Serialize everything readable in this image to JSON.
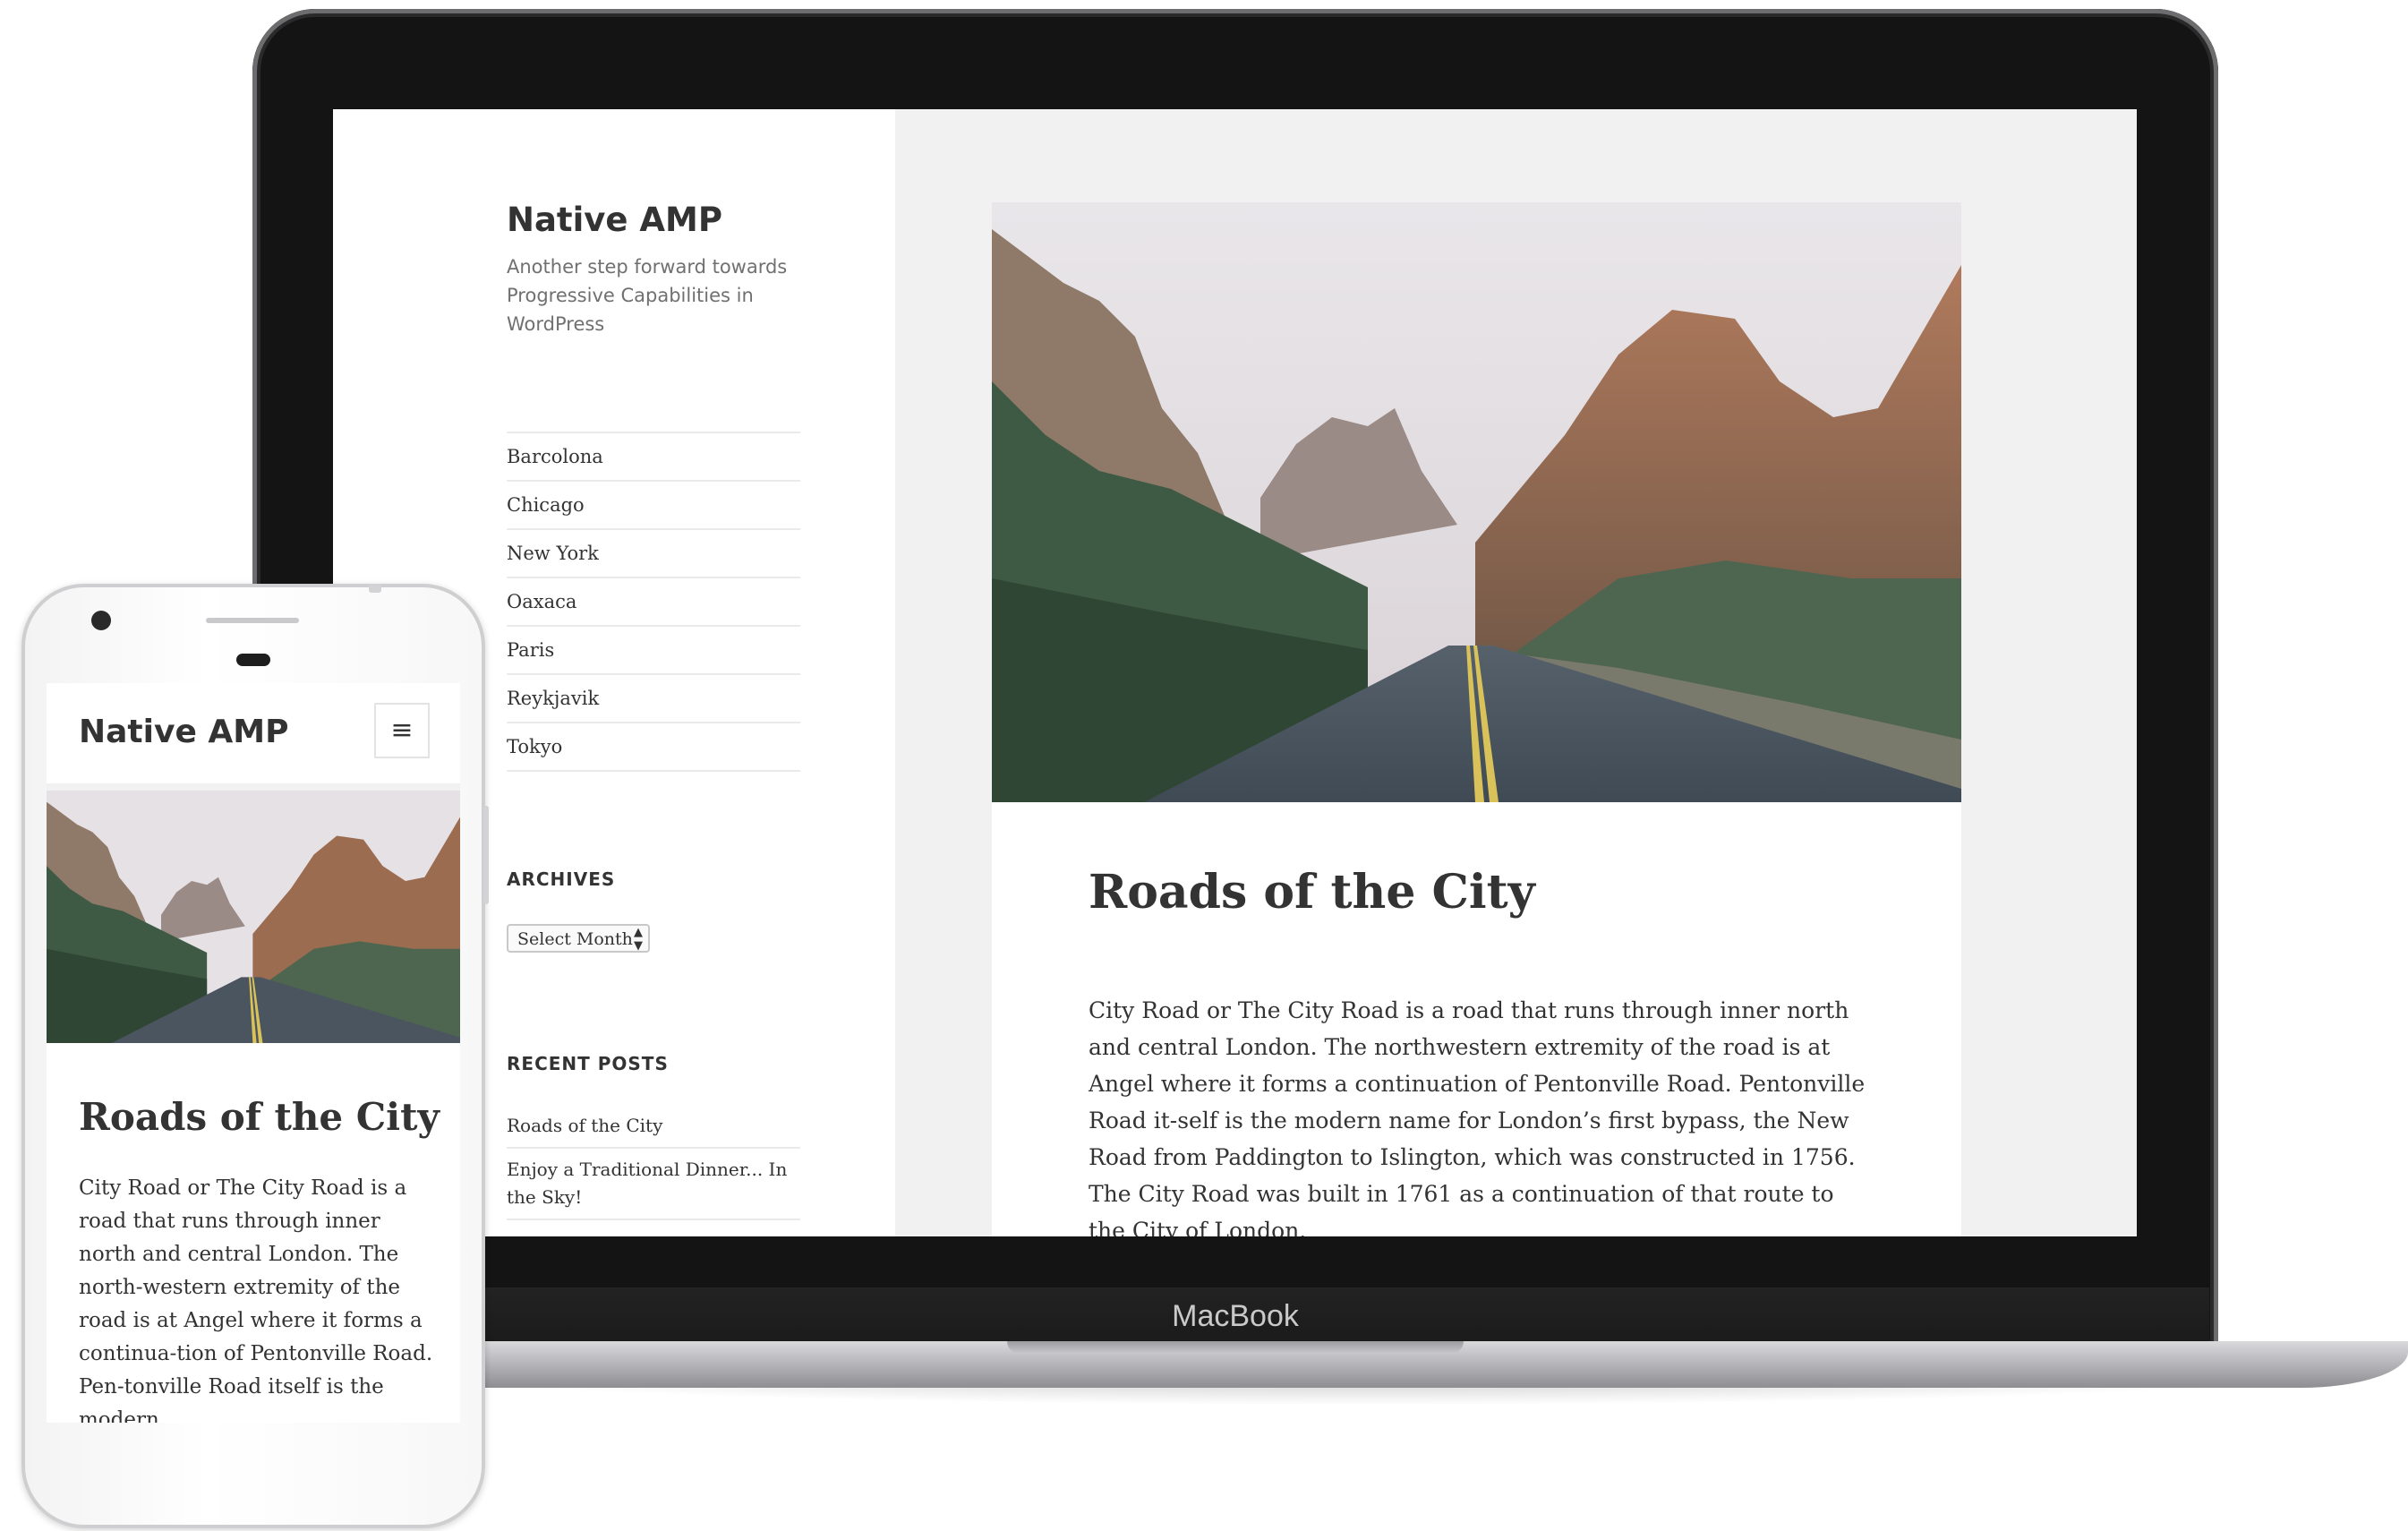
{
  "desktop": {
    "device_label": "MacBook",
    "site": {
      "title": "Native AMP",
      "description": "Another step forward towards Progressive Capabilities in WordPress"
    },
    "menu": [
      "Barcolona",
      "Chicago",
      "New York",
      "Oaxaca",
      "Paris",
      "Reykjavik",
      "Tokyo"
    ],
    "archives": {
      "heading": "ARCHIVES",
      "select_value": "Select Month"
    },
    "recent_posts": {
      "heading": "RECENT POSTS",
      "items": [
        "Roads of the City",
        "Enjoy a Traditional Dinner... In the Sky!"
      ]
    },
    "post": {
      "title": "Roads of the City",
      "body": "City Road or The City Road is a road that runs through inner north and central London. The northwestern extremity of the road is at Angel where it forms a continuation of Pentonville Road. Pentonville Road it-self is the modern name for London’s first bypass, the New Road from Paddington to Islington, which was constructed in 1756. The City Road was built in 1761 as a continuation of that route to the City of London."
    }
  },
  "mobile": {
    "site_title": "Native AMP",
    "menu_icon": "hamburger-icon",
    "post": {
      "title": "Roads of the City",
      "body": "City Road or The City Road is a road that runs through inner north and central London. The north-western extremity of the road is at Angel where it forms a continua-tion of Pentonville Road. Pen-tonville Road itself is the modern"
    }
  },
  "colors": {
    "text": "#333333",
    "muted": "#707070",
    "background": "#f1f1f1",
    "bezel": "#141414"
  }
}
